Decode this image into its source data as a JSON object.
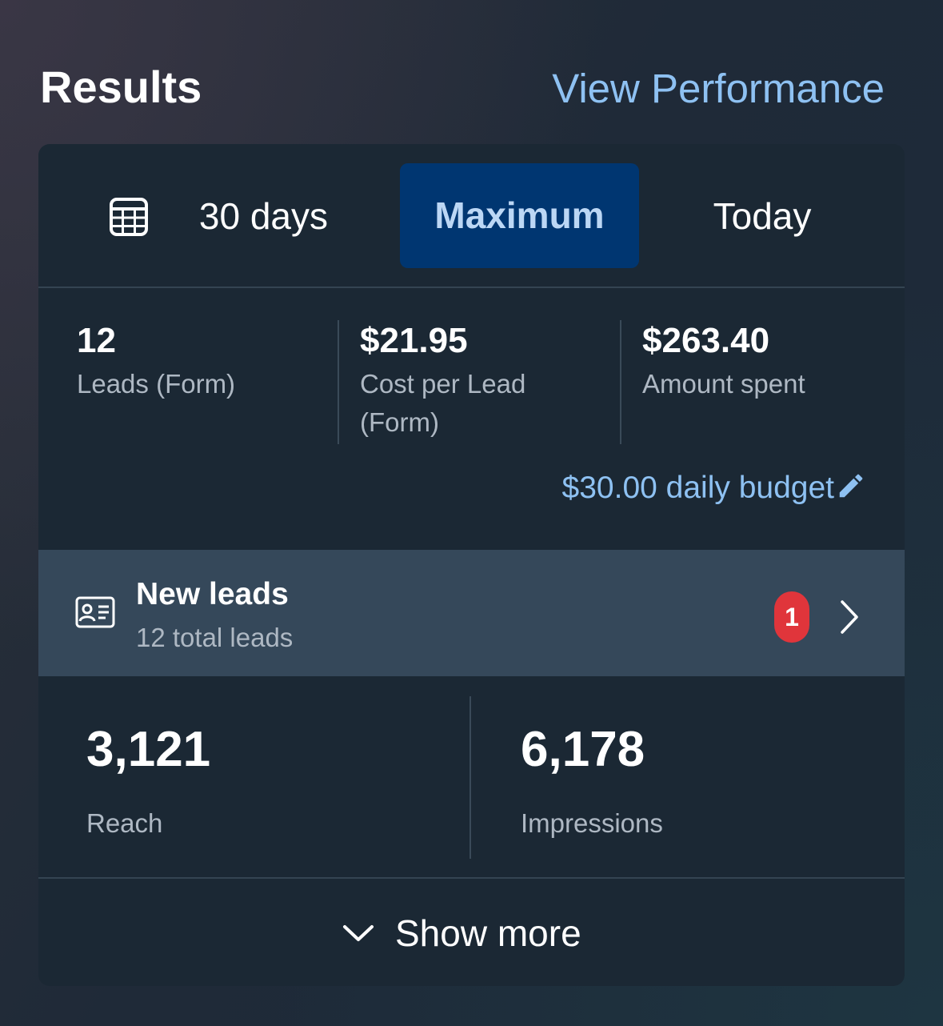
{
  "header": {
    "title": "Results",
    "link": "View Performance"
  },
  "tabs": {
    "icon": "calendar-table-icon",
    "last_30": "30 days",
    "maximum": "Maximum",
    "today": "Today",
    "selected": "Maximum"
  },
  "metrics": [
    {
      "value": "12",
      "label_1": "Leads (Form)",
      "label_2": ""
    },
    {
      "value": "$21.95",
      "label_1": "Cost per Lead",
      "label_2": "(Form)"
    },
    {
      "value": "$263.40",
      "label_1": "Amount spent",
      "label_2": ""
    }
  ],
  "budget": {
    "text": "$30.00 daily budget",
    "icon": "pencil-icon"
  },
  "new_leads": {
    "icon": "contact-card-icon",
    "title": "New leads",
    "subtitle": "12 total leads",
    "badge": "1",
    "chevron": "chevron-right-icon"
  },
  "stats": [
    {
      "value": "3,121",
      "label": "Reach"
    },
    {
      "value": "6,178",
      "label": "Impressions"
    }
  ],
  "show_more": {
    "label": "Show more",
    "icon": "chevron-down-icon"
  },
  "colors": {
    "accent": "#8ec1f2",
    "tab_selected_bg": "#003671",
    "badge": "#e0353b",
    "card_bg": "#1b2834",
    "row_bg": "#35485a"
  }
}
